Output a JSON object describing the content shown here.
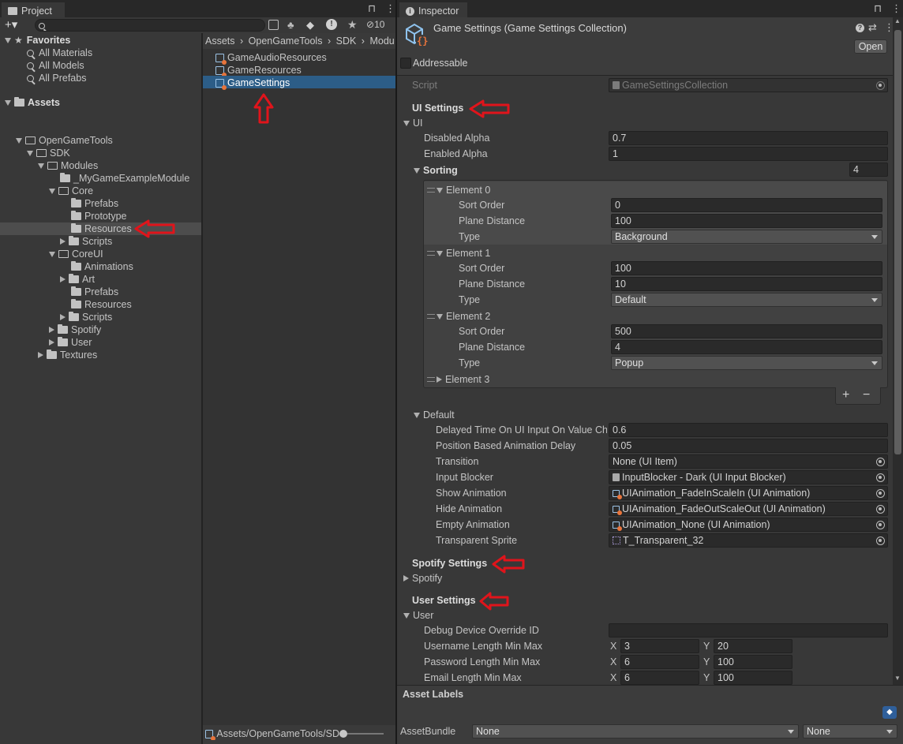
{
  "colors": {
    "accent": "#2c5d87",
    "annotation": "#e0141b",
    "window_bg": "#383838"
  },
  "project": {
    "tab_label": "Project",
    "hidden_count": "10",
    "favorites": {
      "label": "Favorites",
      "items": [
        "All Materials",
        "All Models",
        "All Prefabs"
      ]
    },
    "assets_label": "Assets",
    "tree": [
      "OpenGameTools",
      "SDK",
      "Modules",
      "_MyGameExampleModule",
      "Core",
      "Prefabs",
      "Prototype",
      "Resources",
      "Scripts",
      "CoreUI",
      "Animations",
      "Art",
      "Prefabs",
      "Resources",
      "Scripts",
      "Spotify",
      "User",
      "Textures"
    ],
    "breadcrumb": [
      "Assets",
      "OpenGameTools",
      "SDK",
      "Modu"
    ],
    "files": [
      "GameAudioResources",
      "GameResources",
      "GameSettings"
    ],
    "footer_path": "Assets/OpenGameTools/SD"
  },
  "inspector": {
    "tab_label": "Inspector",
    "title": "Game Settings (Game Settings Collection)",
    "open_button": "Open",
    "addressable_label": "Addressable",
    "script_label": "Script",
    "script_value": "GameSettingsCollection",
    "ui_settings": {
      "header": "UI Settings",
      "foldout": "UI",
      "disabled_alpha_label": "Disabled Alpha",
      "disabled_alpha": "0.7",
      "enabled_alpha_label": "Enabled Alpha",
      "enabled_alpha": "1",
      "sorting_label": "Sorting",
      "sorting_count": "4",
      "elements": [
        {
          "label": "Element 0",
          "sort_order_label": "Sort Order",
          "sort_order": "0",
          "plane_distance_label": "Plane Distance",
          "plane_distance": "100",
          "type_label": "Type",
          "type": "Background"
        },
        {
          "label": "Element 1",
          "sort_order_label": "Sort Order",
          "sort_order": "100",
          "plane_distance_label": "Plane Distance",
          "plane_distance": "10",
          "type_label": "Type",
          "type": "Default"
        },
        {
          "label": "Element 2",
          "sort_order_label": "Sort Order",
          "sort_order": "500",
          "plane_distance_label": "Plane Distance",
          "plane_distance": "4",
          "type_label": "Type",
          "type": "Popup"
        },
        {
          "label": "Element 3"
        }
      ],
      "plus": "+",
      "minus": "−",
      "default_label": "Default",
      "default_rows": [
        {
          "label": "Delayed Time On UI Input On Value Ch",
          "value": "0.6"
        },
        {
          "label": "Position Based Animation Delay",
          "value": "0.05"
        },
        {
          "label": "Transition",
          "value": "None (UI Item)"
        },
        {
          "label": "Input Blocker",
          "value": "InputBlocker - Dark (UI Input Blocker)"
        },
        {
          "label": "Show Animation",
          "value": "UIAnimation_FadeInScaleIn (UI Animation)"
        },
        {
          "label": "Hide Animation",
          "value": "UIAnimation_FadeOutScaleOut (UI Animation)"
        },
        {
          "label": "Empty Animation",
          "value": "UIAnimation_None (UI Animation)"
        },
        {
          "label": "Transparent Sprite",
          "value": "T_Transparent_32"
        }
      ]
    },
    "spotify_settings": {
      "header": "Spotify Settings",
      "foldout": "Spotify"
    },
    "user_settings": {
      "header": "User Settings",
      "foldout": "User",
      "debug_label": "Debug Device Override ID",
      "debug_value": "",
      "rows": [
        {
          "label": "Username Length Min Max",
          "x": "3",
          "y": "20"
        },
        {
          "label": "Password Length Min Max",
          "x": "6",
          "y": "100"
        },
        {
          "label": "Email Length Min Max",
          "x": "6",
          "y": "100"
        }
      ],
      "x_label": "X",
      "y_label": "Y"
    },
    "asset_labels": "Asset Labels",
    "assetbundle_label": "AssetBundle",
    "assetbundle_value": "None",
    "assetbundle_variant": "None"
  }
}
